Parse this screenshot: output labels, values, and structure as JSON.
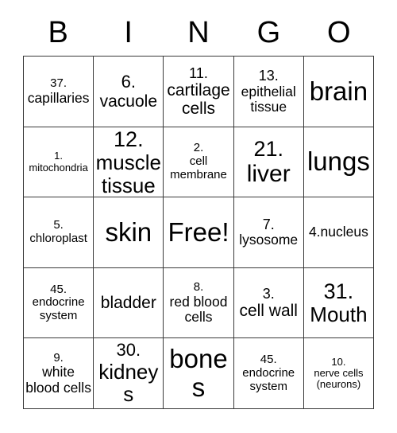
{
  "card": {
    "title": "BINGO",
    "header": [
      "B",
      "I",
      "N",
      "G",
      "O"
    ],
    "free_space_label": "Free!",
    "colors": {
      "border": "#3a3a3a",
      "text": "#000000",
      "background": "#ffffff"
    },
    "rows": [
      [
        {
          "number": "37.",
          "label": "capillaries"
        },
        {
          "number": "6.",
          "label": "vacuole"
        },
        {
          "number": "11.",
          "label": "cartilage cells"
        },
        {
          "number": "13.",
          "label": "epithelial tissue"
        },
        {
          "number": "",
          "label": "brain"
        }
      ],
      [
        {
          "number": "1.",
          "label": "mitochondria"
        },
        {
          "number": "12.",
          "label": "muscle tissue"
        },
        {
          "number": "2.",
          "label": "cell membrane"
        },
        {
          "number": "21.",
          "label": "liver"
        },
        {
          "number": "",
          "label": "lungs"
        }
      ],
      [
        {
          "number": "5.",
          "label": "chloroplast"
        },
        {
          "number": "",
          "label": "skin"
        },
        {
          "number": "",
          "label": "Free!"
        },
        {
          "number": "7.",
          "label": "lysosome"
        },
        {
          "number": "",
          "label": "4.nucleus"
        }
      ],
      [
        {
          "number": "45.",
          "label": "endocrine system"
        },
        {
          "number": "",
          "label": "bladder"
        },
        {
          "number": "8.",
          "label": "red blood cells"
        },
        {
          "number": "3.",
          "label": "cell wall"
        },
        {
          "number": "31.",
          "label": "Mouth"
        }
      ],
      [
        {
          "number": "9.",
          "label": "white blood cells"
        },
        {
          "number": "30.",
          "label": "kidneys"
        },
        {
          "number": "",
          "label": "bones"
        },
        {
          "number": "45.",
          "label": "endocrine system"
        },
        {
          "number": "10.",
          "label": "nerve cells (neurons)"
        }
      ]
    ]
  }
}
